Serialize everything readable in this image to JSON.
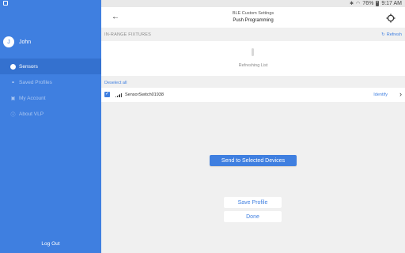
{
  "status_bar": {
    "battery": "76%",
    "time": "9:17 AM",
    "icons": [
      "bluetooth-icon",
      "wifi-icon",
      "battery-icon",
      "screen-icon"
    ]
  },
  "sidebar": {
    "user_initial": "J",
    "user_name": "John",
    "items": [
      {
        "label": "Sensors",
        "icon": "sensors-dot-icon",
        "active": true
      },
      {
        "label": "Saved Profiles",
        "icon": "profiles-icon",
        "active": false
      },
      {
        "label": "My Account",
        "icon": "account-icon",
        "active": false
      },
      {
        "label": "About VLP",
        "icon": "info-icon",
        "active": false
      }
    ],
    "logout": "Log Out"
  },
  "header": {
    "title": "BLE Custom Settings",
    "subtitle": "Push Programming"
  },
  "fixtures": {
    "section_title": "IN-RANGE FIXTURES",
    "refresh_label": "Refresh",
    "refreshing_text": "Refreshing List",
    "deselect_all": "Deselect all",
    "devices": [
      {
        "name": "SensorSwitch01938",
        "action": "Identify",
        "checked": true
      }
    ]
  },
  "actions": {
    "send": "Send to Selected Devices",
    "save_profile": "Save Profile",
    "done": "Done"
  },
  "colors": {
    "primary": "#3f7fe0",
    "sidebar_active": "#3471cf",
    "background": "#f0f0f0"
  }
}
